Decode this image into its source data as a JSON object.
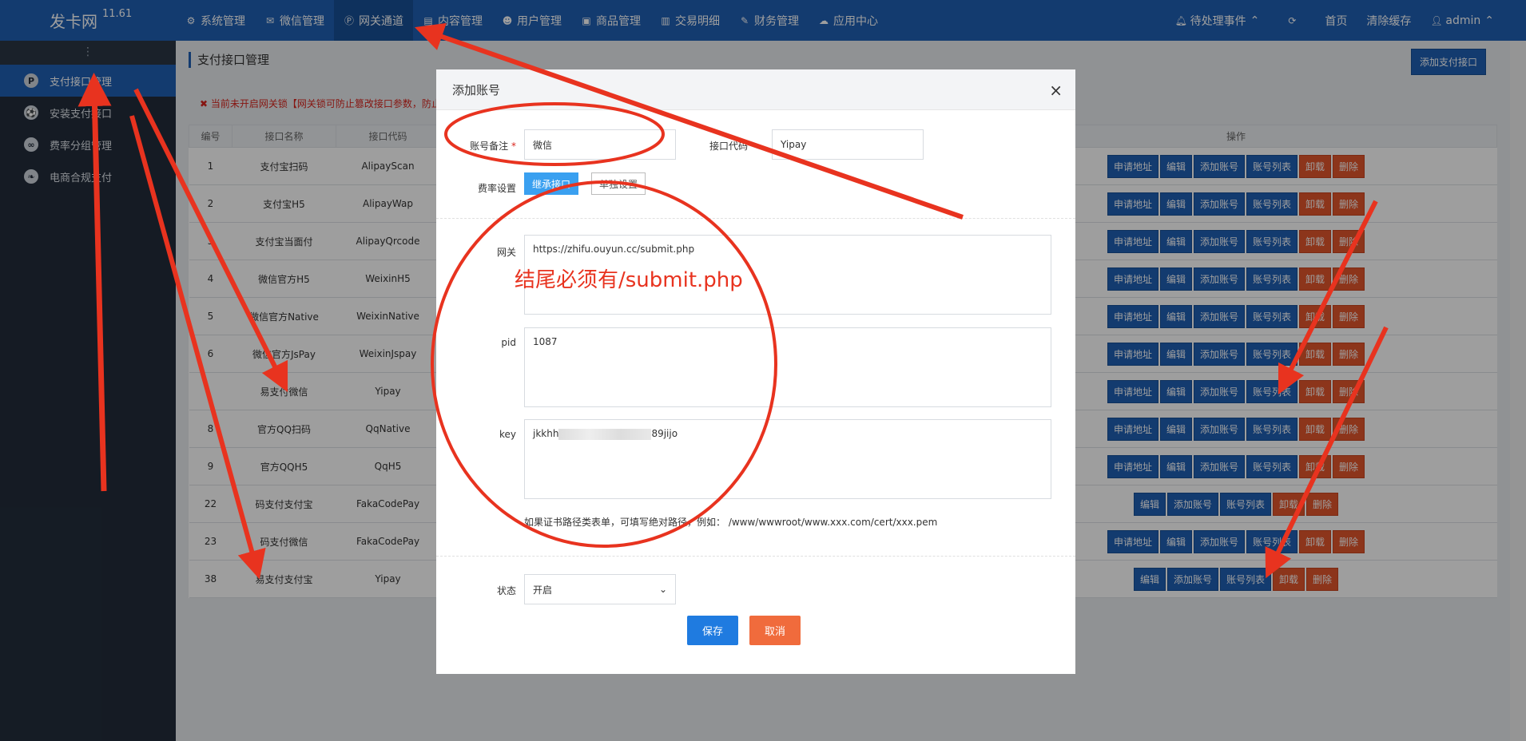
{
  "brand": {
    "name": "发卡网",
    "version": "11.61"
  },
  "nav": [
    {
      "icon": "gear-icon",
      "glyph": "⚙",
      "label": "系统管理"
    },
    {
      "icon": "wechat-icon",
      "glyph": "✉",
      "label": "微信管理"
    },
    {
      "icon": "gateway-icon",
      "glyph": "Ⓟ",
      "label": "网关通道",
      "active": true
    },
    {
      "icon": "document-icon",
      "glyph": "▤",
      "label": "内容管理"
    },
    {
      "icon": "users-icon",
      "glyph": "☻",
      "label": "用户管理"
    },
    {
      "icon": "shop-icon",
      "glyph": "▣",
      "label": "商品管理"
    },
    {
      "icon": "bar-chart-icon",
      "glyph": "▥",
      "label": "交易明细"
    },
    {
      "icon": "finance-icon",
      "glyph": "✎",
      "label": "财务管理"
    },
    {
      "icon": "cloud-icon",
      "glyph": "☁",
      "label": "应用中心"
    }
  ],
  "nav_right": {
    "pending": "待处理事件",
    "home": "首页",
    "clear_cache": "清除缓存",
    "user": "admin"
  },
  "sidebar": [
    {
      "icon": "P",
      "label": "支付接口管理",
      "active": true
    },
    {
      "icon": "⚽",
      "label": "安装支付接口"
    },
    {
      "icon": "∞",
      "label": "费率分组管理"
    },
    {
      "icon": "❧",
      "label": "电商合规支付"
    }
  ],
  "page": {
    "title": "支付接口管理",
    "add_button": "添加支付接口",
    "warning": "✖ 当前未开启网关锁【网关锁可防止篡改接口参数，防止"
  },
  "table": {
    "headers": [
      "编号",
      "接口名称",
      "接口代码",
      "操作"
    ],
    "rows": [
      {
        "id": "1",
        "name": "支付宝扫码",
        "code": "AlipayScan",
        "ops": [
          "申请地址",
          "编辑",
          "添加账号",
          "账号列表",
          "卸载",
          "删除"
        ]
      },
      {
        "id": "2",
        "name": "支付宝H5",
        "code": "AlipayWap",
        "ops": [
          "申请地址",
          "编辑",
          "添加账号",
          "账号列表",
          "卸载",
          "删除"
        ]
      },
      {
        "id": "3",
        "name": "支付宝当面付",
        "code": "AlipayQrcode",
        "ops": [
          "申请地址",
          "编辑",
          "添加账号",
          "账号列表",
          "卸载",
          "删除"
        ]
      },
      {
        "id": "4",
        "name": "微信官方H5",
        "code": "WeixinH5",
        "ops": [
          "申请地址",
          "编辑",
          "添加账号",
          "账号列表",
          "卸载",
          "删除"
        ]
      },
      {
        "id": "5",
        "name": "微信官方Native",
        "code": "WeixinNative",
        "ops": [
          "申请地址",
          "编辑",
          "添加账号",
          "账号列表",
          "卸载",
          "删除"
        ]
      },
      {
        "id": "6",
        "name": "微信官方JsPay",
        "code": "WeixinJspay",
        "ops": [
          "申请地址",
          "编辑",
          "添加账号",
          "账号列表",
          "卸载",
          "删除"
        ]
      },
      {
        "id": "",
        "name": "易支付微信",
        "code": "Yipay",
        "ops": [
          "申请地址",
          "编辑",
          "添加账号",
          "账号列表",
          "卸载",
          "删除"
        ]
      },
      {
        "id": "8",
        "name": "官方QQ扫码",
        "code": "QqNative",
        "ops": [
          "申请地址",
          "编辑",
          "添加账号",
          "账号列表",
          "卸载",
          "删除"
        ]
      },
      {
        "id": "9",
        "name": "官方QQH5",
        "code": "QqH5",
        "ops": [
          "申请地址",
          "编辑",
          "添加账号",
          "账号列表",
          "卸载",
          "删除"
        ]
      },
      {
        "id": "22",
        "name": "码支付支付宝",
        "code": "FakaCodePay",
        "ops": [
          "编辑",
          "添加账号",
          "账号列表",
          "卸载",
          "删除"
        ]
      },
      {
        "id": "23",
        "name": "码支付微信",
        "code": "FakaCodePay",
        "ops": [
          "申请地址",
          "编辑",
          "添加账号",
          "账号列表",
          "卸载",
          "删除"
        ]
      },
      {
        "id": "38",
        "name": "易支付支付宝",
        "code": "Yipay",
        "ops": [
          "编辑",
          "添加账号",
          "账号列表",
          "卸载",
          "删除"
        ]
      }
    ]
  },
  "modal": {
    "title": "添加账号",
    "close": "×",
    "remark_label": "账号备注",
    "remark_required": "*",
    "remark_value": "微信",
    "code_label": "接口代码",
    "code_value": "Yipay",
    "rate_label": "费率设置",
    "rate_inherit": "继承接口",
    "rate_custom": "单独设置",
    "gateway_label": "网关",
    "gateway_value": "https://zhifu.ouyun.cc/submit.php",
    "pid_label": "pid",
    "pid_value": "1087",
    "key_label": "key",
    "key_prefix": "jkkhh",
    "key_suffix": "89jijo",
    "cert_hint": "如果证书路径类表单，可填写绝对路径，例如：  /www/wwwroot/www.xxx.com/cert/xxx.pem",
    "status_label": "状态",
    "status_value": "开启",
    "save": "保存",
    "cancel": "取消"
  },
  "annotation": {
    "text": "结尾必须有/submit.php",
    "color": "#e8331f"
  }
}
